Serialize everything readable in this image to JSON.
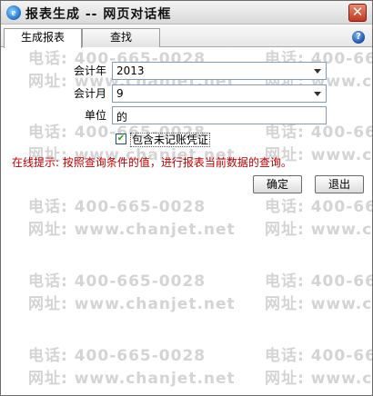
{
  "window": {
    "title": "报表生成 -- 网页对话框",
    "app_icon_glyph": "e",
    "close_glyph": "✕"
  },
  "tabs": [
    {
      "label": "生成报表",
      "active": true
    },
    {
      "label": "查找",
      "active": false
    }
  ],
  "help_glyph": "?",
  "watermark": {
    "phone": "电话: 400-665-0028",
    "site": "网址: www.chanjet.net"
  },
  "form": {
    "year": {
      "label": "会计年",
      "value": "2013"
    },
    "month": {
      "label": "会计月",
      "value": "9"
    },
    "unit": {
      "label": "单位",
      "value": "的"
    },
    "include_unposted": {
      "label": "包含未记账凭证",
      "checked": true
    }
  },
  "hint": "在线提示: 按照查询条件的值，进行报表当前数据的查询。",
  "buttons": {
    "ok": "确定",
    "exit": "退出"
  },
  "colors": {
    "hint": "#c00000",
    "close_button": "#c2391e",
    "watermark": "#d4d4d4"
  }
}
